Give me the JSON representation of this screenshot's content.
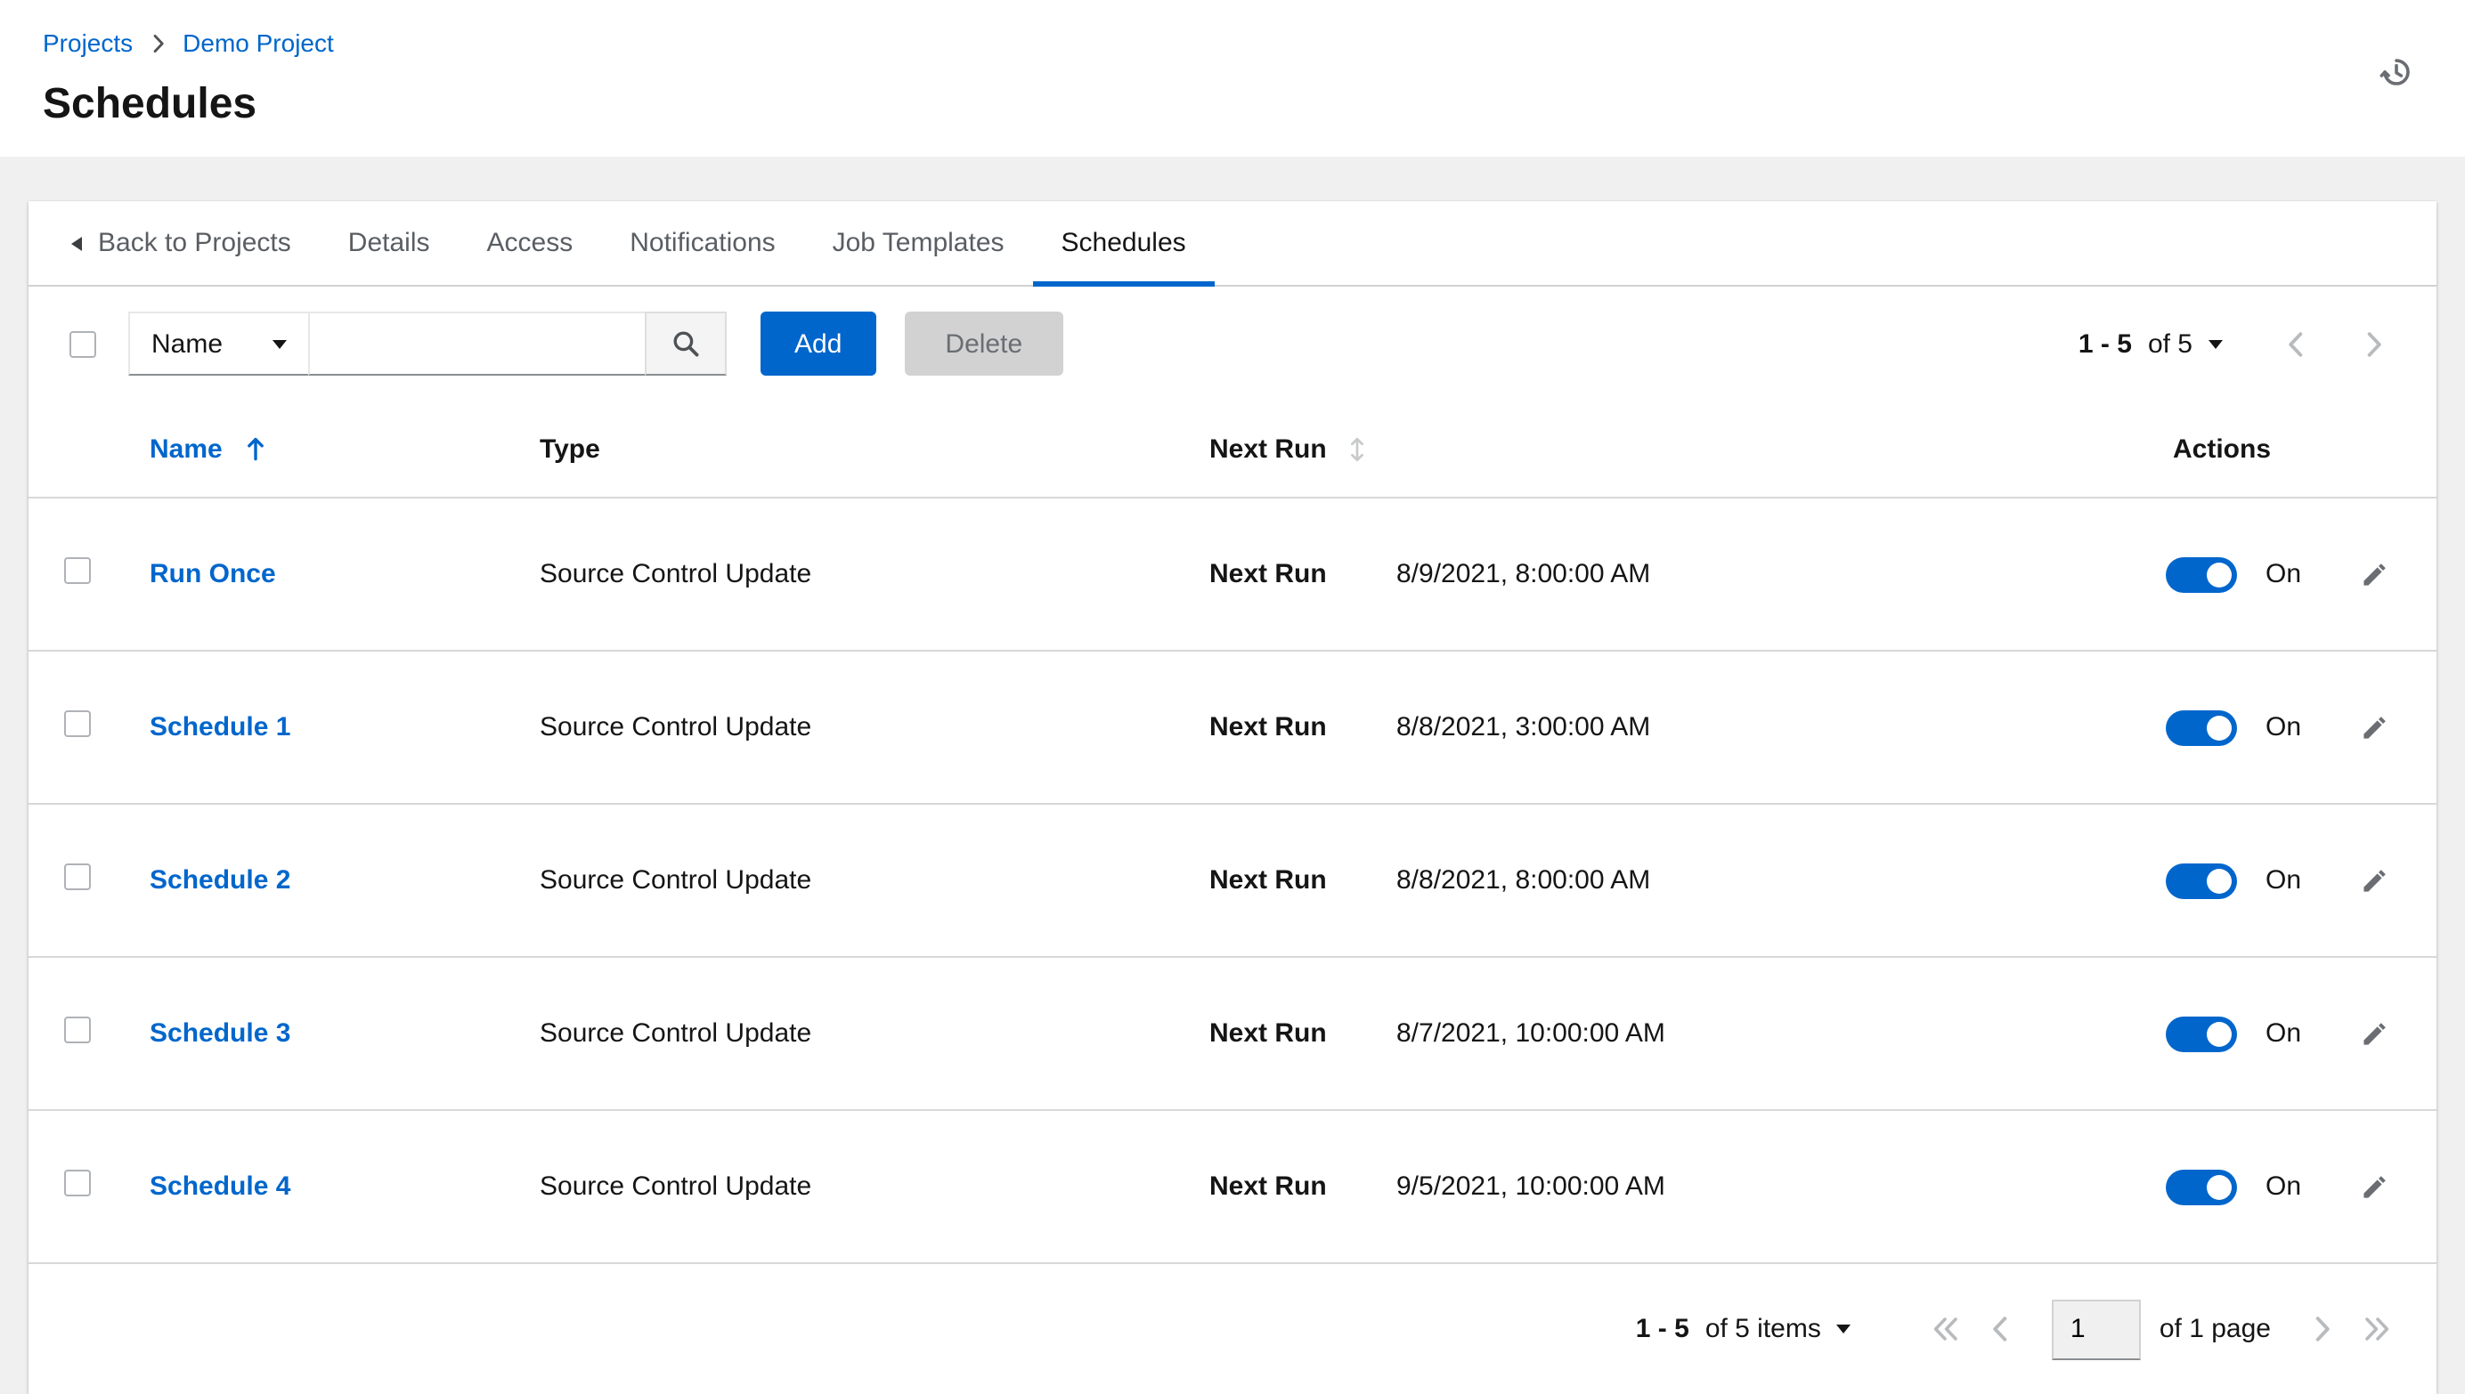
{
  "colors": {
    "accent": "#0066cc"
  },
  "icons": {
    "history": "history-icon",
    "breadcrumb_separator": "angle-right-icon",
    "back": "caret-left-icon",
    "select_caret": "caret-down-icon",
    "search": "search-icon",
    "sort_ascending": "sort-ascending-icon",
    "sort_inactive": "sort-icon",
    "edit": "pencil-icon",
    "first_page": "double-angle-left-icon",
    "prev_page": "angle-left-icon",
    "next_page": "angle-right-icon",
    "last_page": "double-angle-right-icon"
  },
  "breadcrumb": {
    "items": [
      "Projects",
      "Demo Project"
    ]
  },
  "page": {
    "title": "Schedules"
  },
  "tabs": {
    "back_label": "Back to Projects",
    "items": [
      {
        "label": "Details",
        "active": false
      },
      {
        "label": "Access",
        "active": false
      },
      {
        "label": "Notifications",
        "active": false
      },
      {
        "label": "Job Templates",
        "active": false
      },
      {
        "label": "Schedules",
        "active": true
      }
    ]
  },
  "toolbar": {
    "filter": {
      "selected": "Name"
    },
    "search": {
      "value": "",
      "placeholder": ""
    },
    "add_label": "Add",
    "delete_label": "Delete",
    "delete_disabled": true,
    "pagination": {
      "range": "1 - 5",
      "of": "of 5"
    }
  },
  "table": {
    "headers": {
      "name": "Name",
      "type": "Type",
      "next_run": "Next Run",
      "actions": "Actions"
    },
    "sort": {
      "column": "Name",
      "direction": "ascending"
    },
    "rows": [
      {
        "name": "Run Once",
        "type": "Source Control Update",
        "next_run_label": "Next Run",
        "next_run_value": "8/9/2021, 8:00:00 AM",
        "toggle_state": "On"
      },
      {
        "name": "Schedule 1",
        "type": "Source Control Update",
        "next_run_label": "Next Run",
        "next_run_value": "8/8/2021, 3:00:00 AM",
        "toggle_state": "On"
      },
      {
        "name": "Schedule 2",
        "type": "Source Control Update",
        "next_run_label": "Next Run",
        "next_run_value": "8/8/2021, 8:00:00 AM",
        "toggle_state": "On"
      },
      {
        "name": "Schedule 3",
        "type": "Source Control Update",
        "next_run_label": "Next Run",
        "next_run_value": "8/7/2021, 10:00:00 AM",
        "toggle_state": "On"
      },
      {
        "name": "Schedule 4",
        "type": "Source Control Update",
        "next_run_label": "Next Run",
        "next_run_value": "9/5/2021, 10:00:00 AM",
        "toggle_state": "On"
      }
    ]
  },
  "footer": {
    "pagination": {
      "range": "1 - 5",
      "of": "of 5 items",
      "page_value": "1",
      "page_of": "of 1 page"
    }
  }
}
